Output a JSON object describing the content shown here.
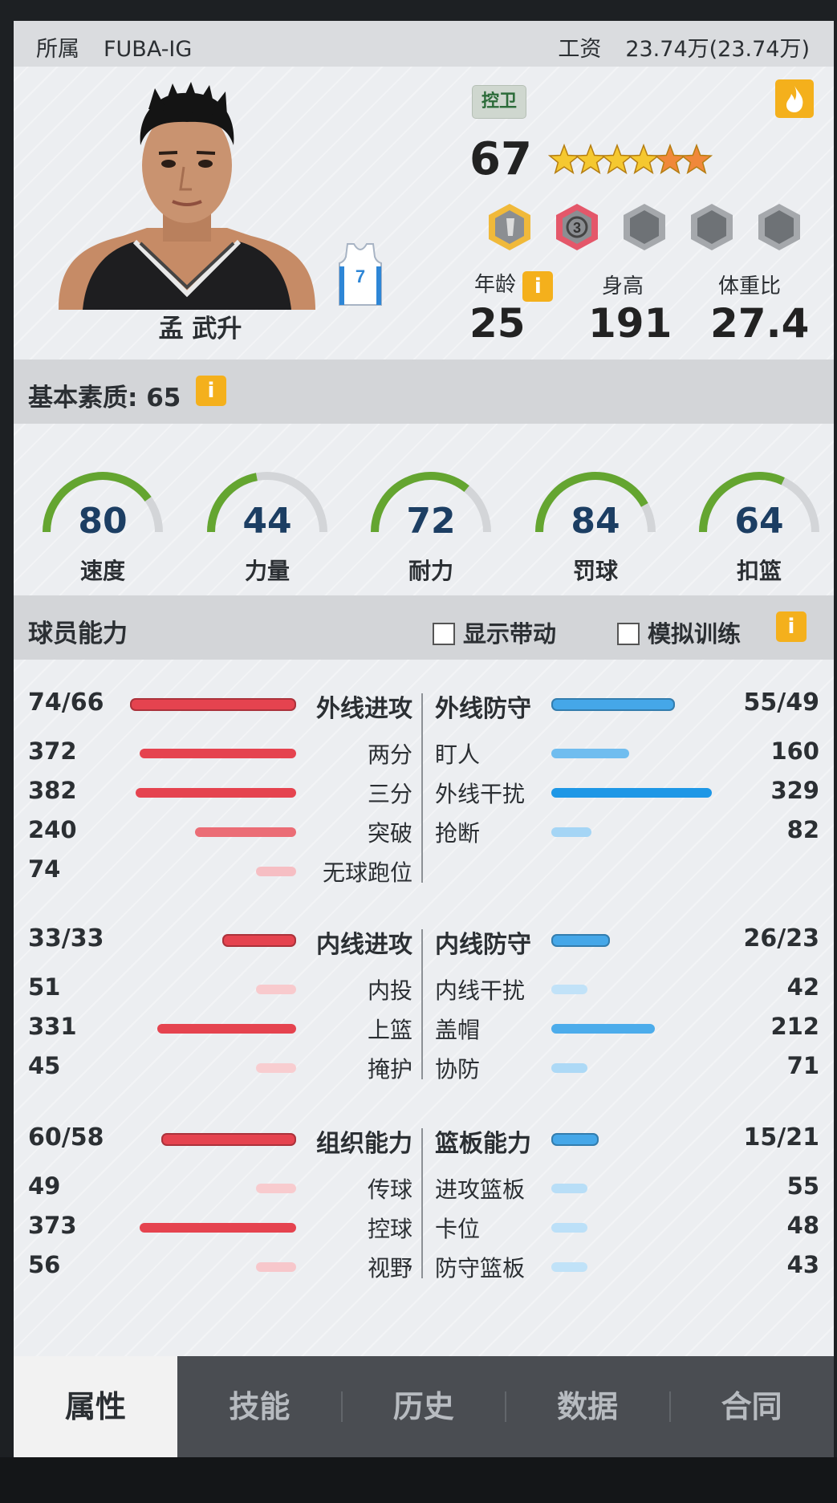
{
  "header": {
    "affiliation_label": "所属",
    "team": "FUBA-IG",
    "salary_label": "工资",
    "salary_value": "23.74万(23.74万)"
  },
  "player": {
    "name": "孟 武升",
    "jersey_number": "7",
    "position": "控卫",
    "overall": "67",
    "star_rating": 6,
    "age_label": "年龄",
    "age": "25",
    "height_label": "身高",
    "height": "191",
    "weight_ratio_label": "体重比",
    "weight_ratio": "27.4"
  },
  "basic": {
    "title": "基本素质: 65",
    "info_glyph": "i",
    "gauges": [
      {
        "label": "速度",
        "value": "80"
      },
      {
        "label": "力量",
        "value": "44"
      },
      {
        "label": "耐力",
        "value": "72"
      },
      {
        "label": "罚球",
        "value": "84"
      },
      {
        "label": "扣篮",
        "value": "64"
      }
    ]
  },
  "ability": {
    "title": "球员能力",
    "show_trend_label": "显示带动",
    "sim_training_label": "模拟训练",
    "info_glyph": "i",
    "groups": [
      {
        "left_header": {
          "label": "外线进攻",
          "value": "74/66",
          "level": 0.74
        },
        "right_header": {
          "label": "外线防守",
          "value": "55/49",
          "level": 0.55
        },
        "left_rows": [
          {
            "label": "两分",
            "value": "372"
          },
          {
            "label": "三分",
            "value": "382"
          },
          {
            "label": "突破",
            "value": "240"
          },
          {
            "label": "无球跑位",
            "value": "74"
          }
        ],
        "right_rows": [
          {
            "label": "盯人",
            "value": "160"
          },
          {
            "label": "外线干扰",
            "value": "329"
          },
          {
            "label": "抢断",
            "value": "82"
          }
        ]
      },
      {
        "left_header": {
          "label": "内线进攻",
          "value": "33/33",
          "level": 0.33
        },
        "right_header": {
          "label": "内线防守",
          "value": "26/23",
          "level": 0.26
        },
        "left_rows": [
          {
            "label": "内投",
            "value": "51"
          },
          {
            "label": "上篮",
            "value": "331"
          },
          {
            "label": "掩护",
            "value": "45"
          }
        ],
        "right_rows": [
          {
            "label": "内线干扰",
            "value": "42"
          },
          {
            "label": "盖帽",
            "value": "212"
          },
          {
            "label": "协防",
            "value": "71"
          }
        ]
      },
      {
        "left_header": {
          "label": "组织能力",
          "value": "60/58",
          "level": 0.6
        },
        "right_header": {
          "label": "篮板能力",
          "value": "15/21",
          "level": 0.21
        },
        "left_rows": [
          {
            "label": "传球",
            "value": "49"
          },
          {
            "label": "控球",
            "value": "373"
          },
          {
            "label": "视野",
            "value": "56"
          }
        ],
        "right_rows": [
          {
            "label": "进攻篮板",
            "value": "55"
          },
          {
            "label": "卡位",
            "value": "48"
          },
          {
            "label": "防守篮板",
            "value": "43"
          }
        ]
      }
    ]
  },
  "tabs": [
    {
      "label": "属性",
      "active": true
    },
    {
      "label": "技能"
    },
    {
      "label": "历史"
    },
    {
      "label": "数据"
    },
    {
      "label": "合同"
    }
  ],
  "colors": {
    "attack_red": "#e5434f",
    "defense_blue": "#1e97e6",
    "gauge_green": "#64a530",
    "accent_yellow": "#f4b01c"
  }
}
